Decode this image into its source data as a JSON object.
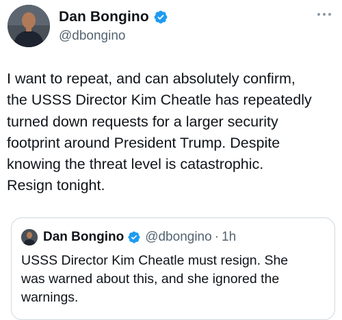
{
  "author": {
    "display_name": "Dan Bongino",
    "handle": "@dbongino",
    "verified": true,
    "verified_color": "#1d9bf0"
  },
  "tweet": {
    "text_lines": [
      "I want to repeat, and can absolutely confirm,",
      "the USSS Director Kim Cheatle has repeatedly",
      "turned down requests for a larger security",
      "footprint around President Trump. Despite",
      "knowing the threat level is catastrophic.",
      "Resign tonight."
    ]
  },
  "quoted_tweet": {
    "display_name": "Dan Bongino",
    "handle": "@dbongino",
    "separator": "·",
    "time": "1h",
    "verified": true,
    "text_lines": [
      "USSS Director Kim Cheatle must resign. She",
      "was warned about this, and she ignored the",
      "warnings."
    ]
  },
  "icons": {
    "avatar": "avatar-icon",
    "verified": "verified-badge-icon",
    "more": "more-options-icon"
  }
}
